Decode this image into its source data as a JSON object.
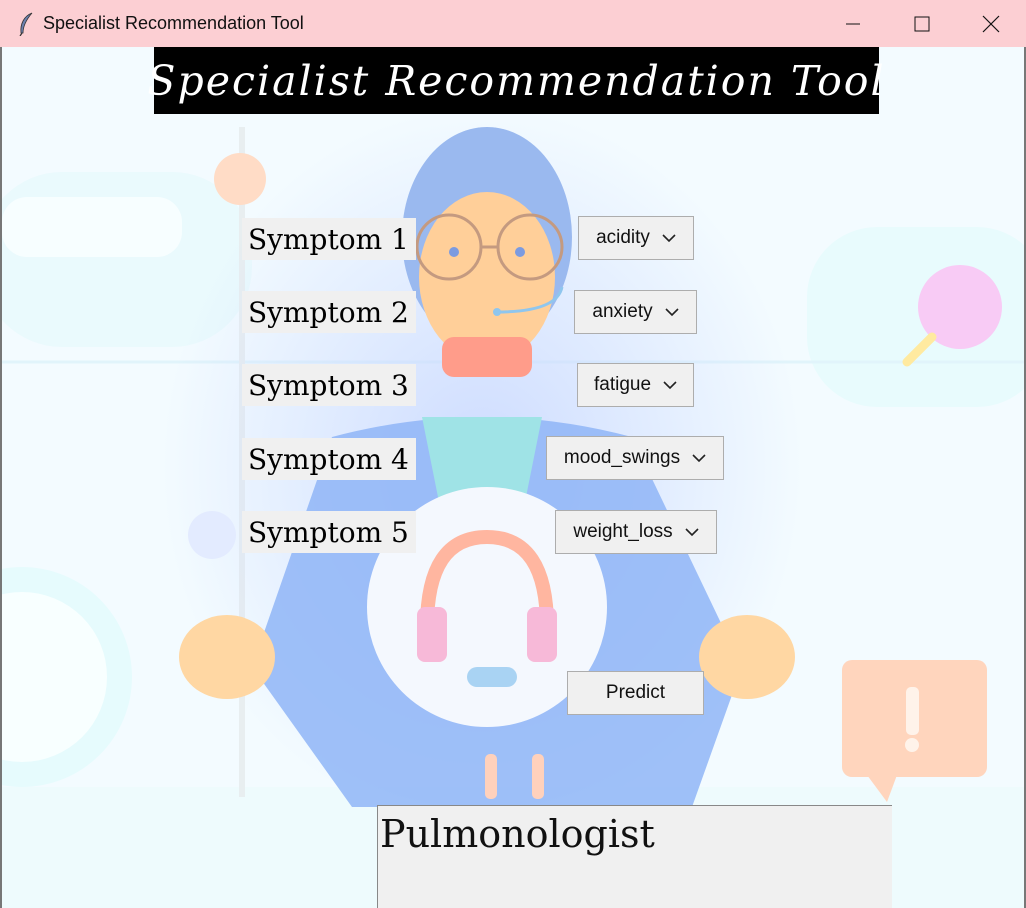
{
  "window": {
    "title": "Specialist Recommendation Tool",
    "titlebar_color": "#fccfd3"
  },
  "header": {
    "title": "Specialist Recommendation Tool"
  },
  "symptoms": [
    {
      "label": "Symptom 1",
      "value": "acidity"
    },
    {
      "label": "Symptom 2",
      "value": "anxiety"
    },
    {
      "label": "Symptom 3",
      "value": "fatigue"
    },
    {
      "label": "Symptom 4",
      "value": "mood_swings"
    },
    {
      "label": "Symptom 5",
      "value": "weight_loss"
    }
  ],
  "predict_label": "Predict",
  "result": {
    "text": "Pulmonologist"
  },
  "icons": [
    "feather-icon",
    "minimize-icon",
    "maximize-icon",
    "close-icon",
    "chevron-down-icon"
  ]
}
